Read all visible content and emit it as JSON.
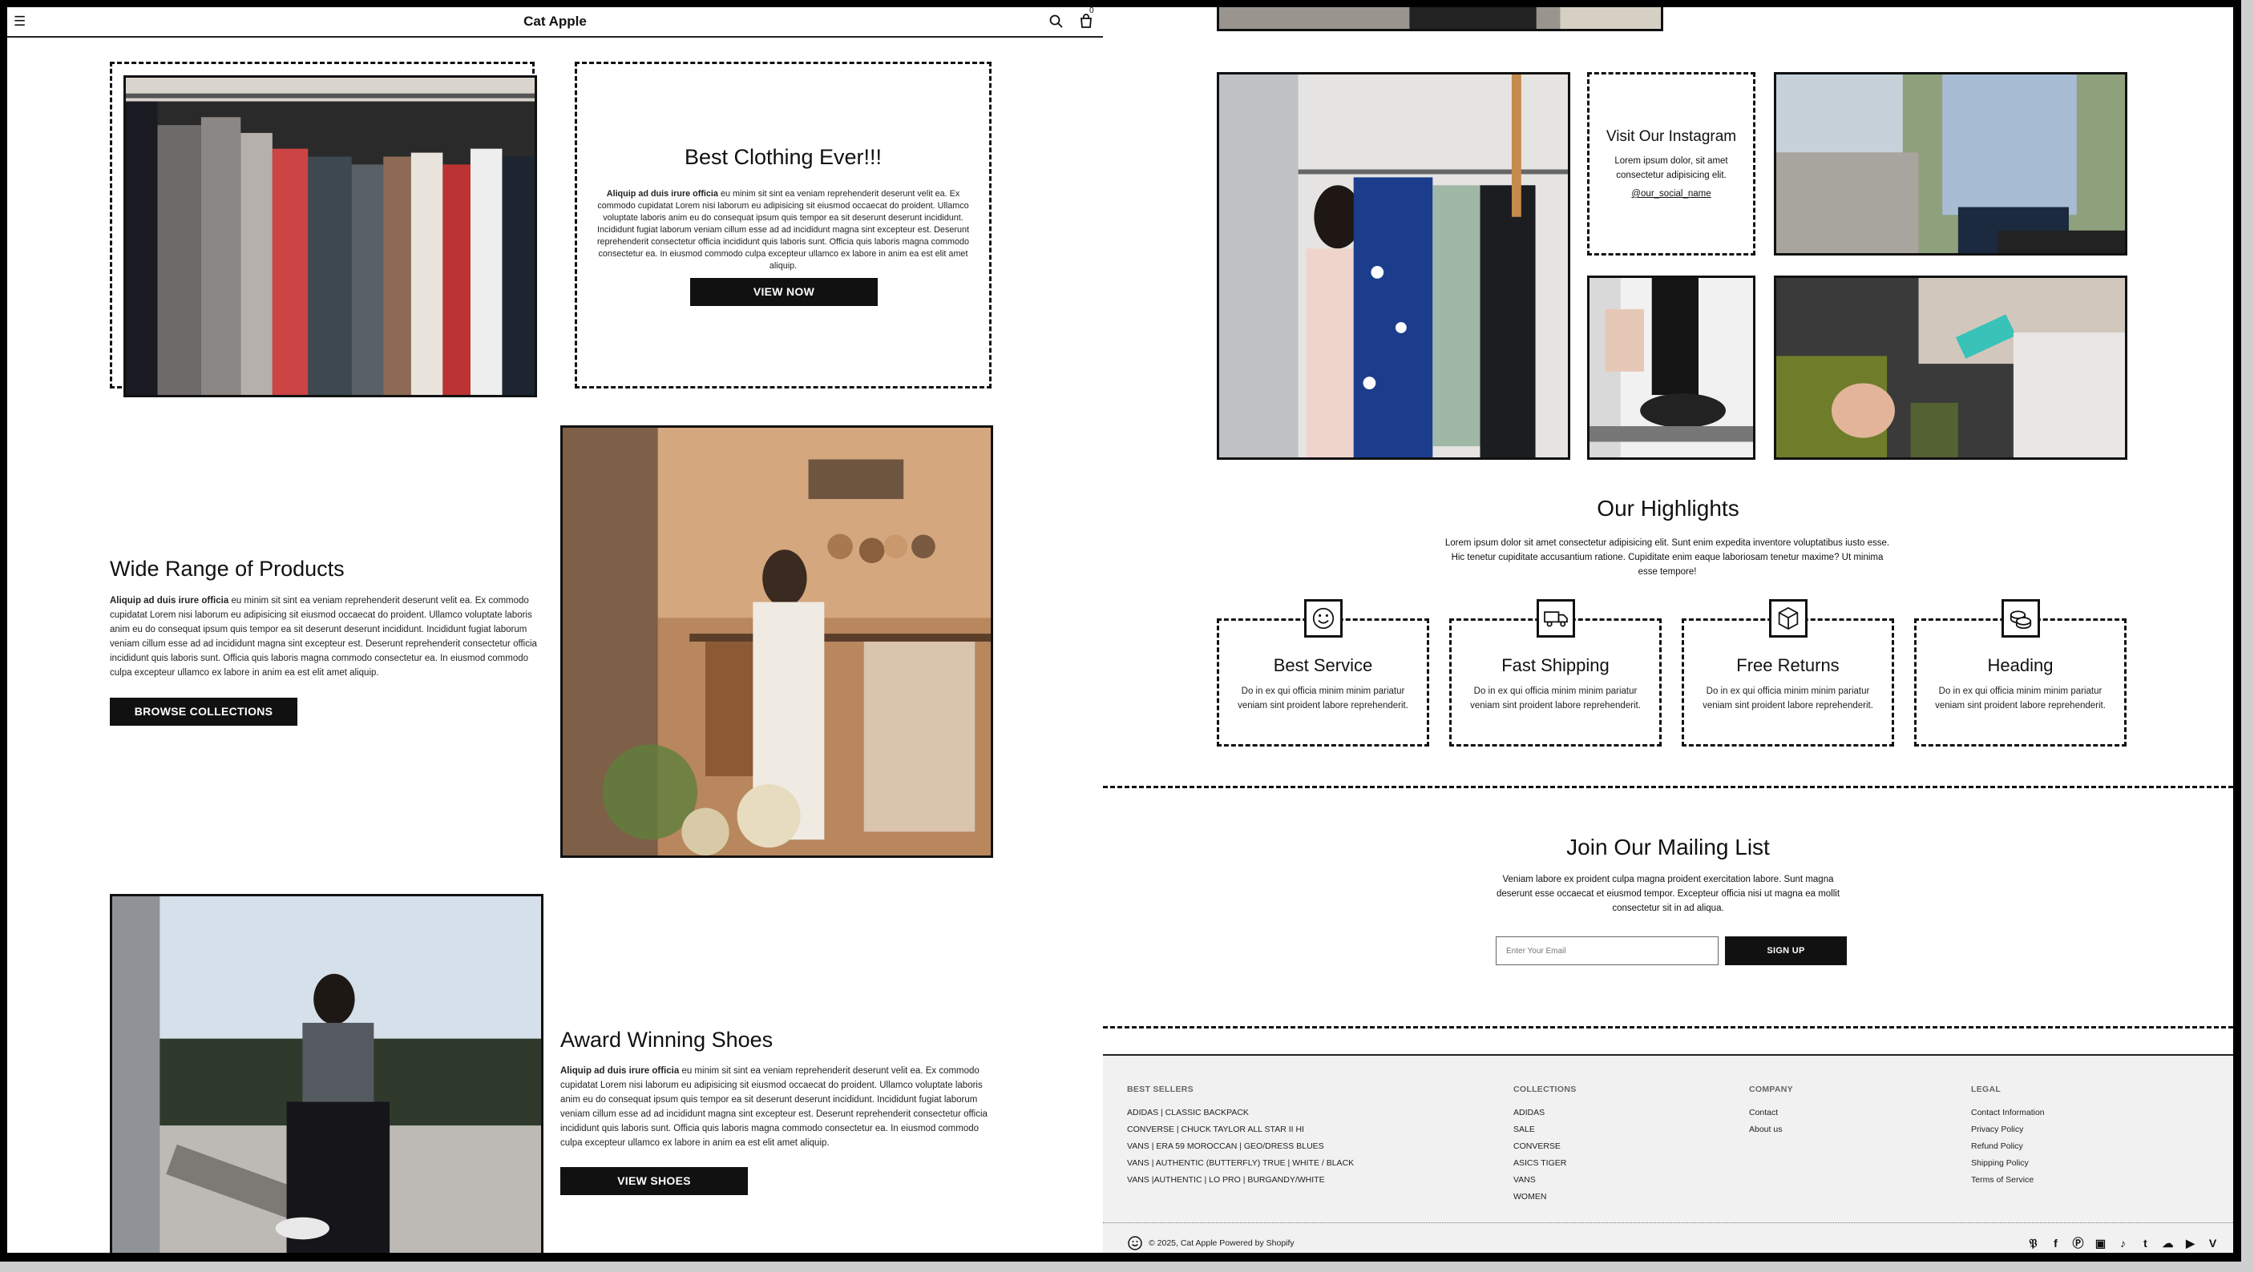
{
  "header": {
    "title": "Cat Apple",
    "cart_count": "0"
  },
  "hero": {
    "title": "Best Clothing Ever!!!",
    "bold_lead": "Aliquip ad duis irure officia",
    "body": " eu minim sit sint ea veniam reprehenderit deserunt velit ea. Ex commodo cupidatat Lorem nisi laborum eu adipisicing sit eiusmod occaecat do proident. Ullamco voluptate laboris anim eu do consequat ipsum quis tempor ea sit deserunt deserunt incididunt. Incididunt fugiat laborum veniam cillum esse ad ad incididunt magna sint excepteur est. Deserunt reprehenderit consectetur officia incididunt quis laboris sunt. Officia quis laboris magna commodo consectetur ea. In eiusmod commodo culpa excepteur ullamco ex labore in anim ea est elit amet aliquip.",
    "button": "VIEW NOW"
  },
  "products": {
    "title": "Wide Range of Products",
    "bold_lead": "Aliquip ad duis irure officia",
    "body": " eu minim sit sint ea veniam reprehenderit deserunt velit ea. Ex commodo cupidatat Lorem nisi laborum eu adipisicing sit eiusmod occaecat do proident. Ullamco voluptate laboris anim eu do consequat ipsum quis tempor ea sit deserunt deserunt incididunt. Incididunt fugiat laborum veniam cillum esse ad ad incididunt magna sint excepteur est. Deserunt reprehenderit consectetur officia incididunt quis laboris sunt. Officia quis laboris magna commodo consectetur ea. In eiusmod commodo culpa excepteur ullamco ex labore in anim ea est elit amet aliquip.",
    "button": "BROWSE COLLECTIONS"
  },
  "shoes": {
    "title": "Award Winning Shoes",
    "bold_lead": "Aliquip ad duis irure officia",
    "body": " eu minim sit sint ea veniam reprehenderit deserunt velit ea. Ex commodo cupidatat Lorem nisi laborum eu adipisicing sit eiusmod occaecat do proident. Ullamco voluptate laboris anim eu do consequat ipsum quis tempor ea sit deserunt deserunt incididunt. Incididunt fugiat laborum veniam cillum esse ad ad incididunt magna sint excepteur est. Deserunt reprehenderit consectetur officia incididunt quis laboris sunt. Officia quis laboris magna commodo consectetur ea. In eiusmod commodo culpa excepteur ullamco ex labore in anim ea est elit amet aliquip.",
    "button": "VIEW SHOES"
  },
  "instagram": {
    "title": "Visit Our Instagram",
    "body": "Lorem ipsum dolor, sit amet consectetur adipisicing elit.",
    "handle": "@our_social_name"
  },
  "highlights": {
    "title": "Our Highlights",
    "body": "Lorem ipsum dolor sit amet consectetur adipisicing elit. Sunt enim expedita inventore voluptatibus iusto esse. Hic tenetur cupiditate accusantium ratione. Cupiditate enim eaque laboriosam tenetur maxime? Ut minima esse tempore!",
    "cards": [
      {
        "title": "Best Service",
        "body": "Do in ex qui officia minim minim pariatur veniam sint proident labore reprehenderit.",
        "icon": "smile-icon"
      },
      {
        "title": "Fast Shipping",
        "body": "Do in ex qui officia minim minim pariatur veniam sint proident labore reprehenderit.",
        "icon": "truck-icon"
      },
      {
        "title": "Free Returns",
        "body": "Do in ex qui officia minim minim pariatur veniam sint proident labore reprehenderit.",
        "icon": "box-icon"
      },
      {
        "title": "Heading",
        "body": "Do in ex qui officia minim minim pariatur veniam sint proident labore reprehenderit.",
        "icon": "coins-icon"
      }
    ]
  },
  "mailing": {
    "title": "Join Our Mailing List",
    "body": "Veniam labore ex proident culpa magna proident exercitation labore. Sunt magna deserunt esse occaecat et eiusmod tempor. Excepteur officia nisi ut magna ea mollit consectetur sit in ad aliqua.",
    "placeholder": "Enter Your Email",
    "button": "SIGN UP"
  },
  "footer": {
    "best_sellers": {
      "heading": "BEST SELLERS",
      "links": [
        "ADIDAS | CLASSIC BACKPACK",
        "CONVERSE | CHUCK TAYLOR ALL STAR II HI",
        "VANS | ERA 59 MOROCCAN | GEO/DRESS BLUES",
        "VANS | AUTHENTIC (BUTTERFLY) TRUE | WHITE / BLACK",
        "VANS |AUTHENTIC | LO PRO | BURGANDY/WHITE"
      ]
    },
    "collections": {
      "heading": "COLLECTIONS",
      "links": [
        "ADIDAS",
        "SALE",
        "CONVERSE",
        "ASICS TIGER",
        "VANS",
        "WOMEN"
      ]
    },
    "company": {
      "heading": "COMPANY",
      "links": [
        "Contact",
        "About us"
      ]
    },
    "legal": {
      "heading": "LEGAL",
      "links": [
        "Contact Information",
        "Privacy Policy",
        "Refund Policy",
        "Shipping Policy",
        "Terms of Service"
      ]
    },
    "copyright": "© 2025, Cat Apple  Powered by Shopify",
    "social": [
      "twitter-icon",
      "facebook-icon",
      "pinterest-icon",
      "instagram-icon",
      "tiktok-icon",
      "tumblr-icon",
      "snapchat-icon",
      "youtube-icon",
      "vimeo-icon"
    ]
  }
}
